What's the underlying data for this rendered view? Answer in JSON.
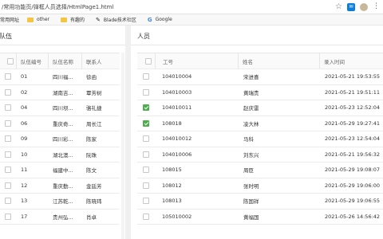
{
  "browser": {
    "url": "/常用功能页/弹框人员选择/HtmlPage1.html",
    "bookmarks": [
      {
        "label": "常用网址",
        "icon": "folder-icon"
      },
      {
        "label": "other",
        "icon": "folder-icon"
      },
      {
        "label": "有趣的",
        "icon": "folder-icon"
      },
      {
        "label": "Blade技术社区",
        "icon": "blade-icon"
      },
      {
        "label": "Google",
        "icon": "google-icon"
      }
    ]
  },
  "left": {
    "title": "队伍",
    "columns": [
      "队伍编号",
      "队伍名称",
      "联系人"
    ],
    "rows": [
      {
        "checked": false,
        "cells": [
          "01",
          "四川福...",
          "徐函"
        ]
      },
      {
        "checked": false,
        "cells": [
          "02",
          "湖南吉...",
          "覃芳树"
        ]
      },
      {
        "checked": false,
        "cells": [
          "04",
          "四川坝...",
          "骆礼捷"
        ]
      },
      {
        "checked": false,
        "cells": [
          "06",
          "重庆奇...",
          "周长江"
        ]
      },
      {
        "checked": false,
        "cells": [
          "09",
          "四川彩...",
          "陈家"
        ]
      },
      {
        "checked": false,
        "cells": [
          "10",
          "湖北澳...",
          "阮珠"
        ]
      },
      {
        "checked": false,
        "cells": [
          "11",
          "福建中...",
          "陈文"
        ]
      },
      {
        "checked": false,
        "cells": [
          "12",
          "重庆勤...",
          "金廷芳"
        ]
      },
      {
        "checked": false,
        "cells": [
          "13",
          "江苏乾...",
          "陈晓玮"
        ]
      },
      {
        "checked": false,
        "cells": [
          "17",
          "贵州弘...",
          "肖卓"
        ]
      }
    ]
  },
  "right": {
    "title": "人员",
    "columns": [
      "工号",
      "姓名",
      "录入时间"
    ],
    "rows": [
      {
        "checked": false,
        "cells": [
          "104010004",
          "宋进喜",
          "2021-05-21 19:53:55"
        ]
      },
      {
        "checked": false,
        "cells": [
          "104010003",
          "黄瑞贵",
          "2021-05-21 19:51:11"
        ]
      },
      {
        "checked": true,
        "cells": [
          "104010011",
          "赵庆雷",
          "2021-05-23 12:52:04"
        ]
      },
      {
        "checked": true,
        "cells": [
          "108018",
          "凌大林",
          "2021-05-29 19:27:41"
        ]
      },
      {
        "checked": false,
        "cells": [
          "104010012",
          "马科",
          "2021-05-23 12:54:04"
        ]
      },
      {
        "checked": false,
        "cells": [
          "104010006",
          "刘东兴",
          "2021-05-21 19:56:32"
        ]
      },
      {
        "checked": false,
        "cells": [
          "108015",
          "周臣",
          "2021-05-29 19:08:07"
        ]
      },
      {
        "checked": false,
        "cells": [
          "108012",
          "张时明",
          "2021-05-29 19:06:00"
        ]
      },
      {
        "checked": false,
        "cells": [
          "108013",
          "陈国祥",
          "2021-05-29 19:06:55"
        ]
      },
      {
        "checked": false,
        "cells": [
          "105010002",
          "黄福国",
          "2021-05-26 14:56:42"
        ]
      }
    ]
  }
}
